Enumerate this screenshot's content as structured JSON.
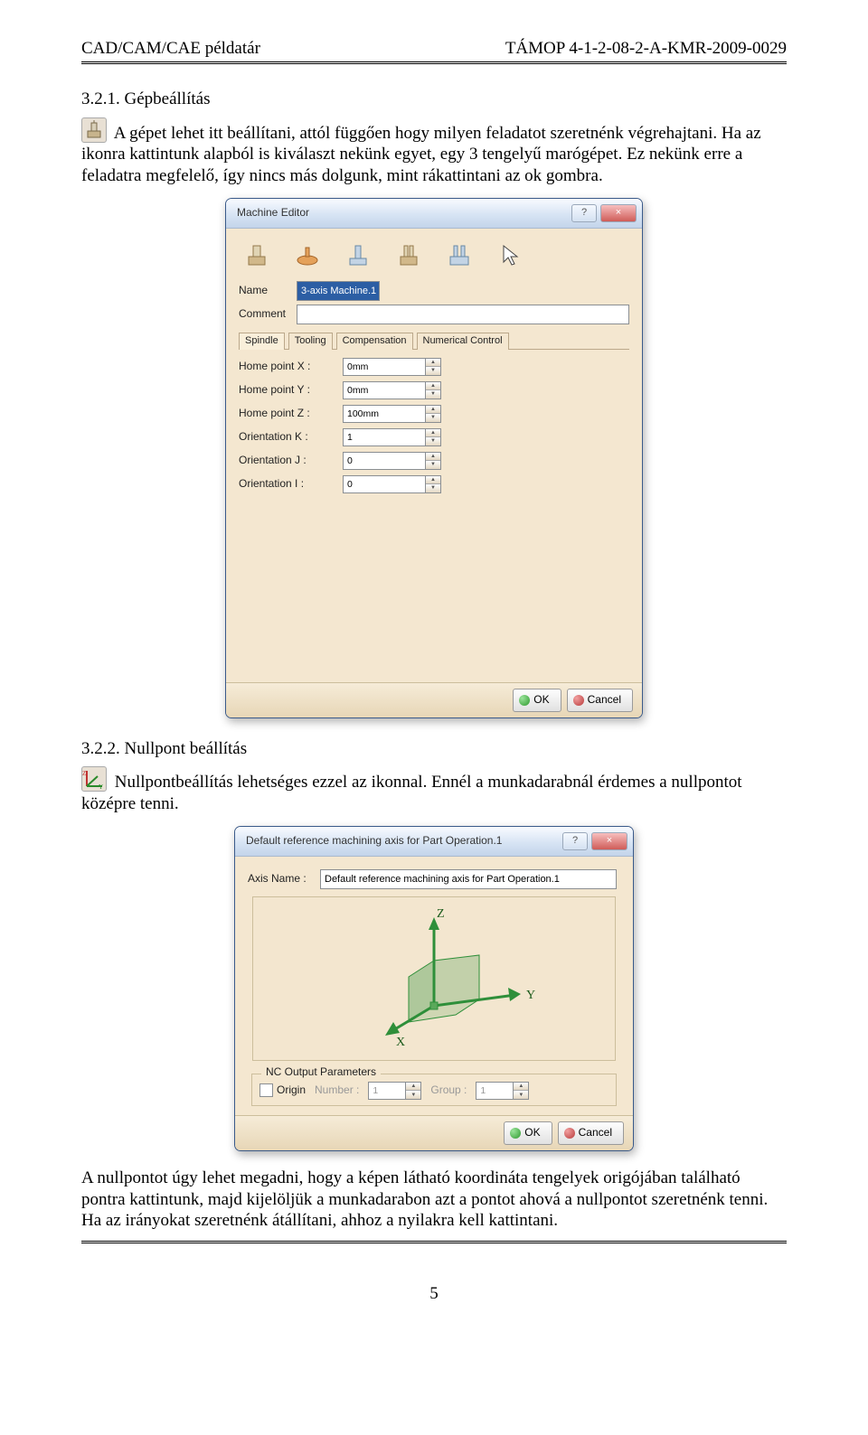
{
  "header": {
    "left": "CAD/CAM/CAE példatár",
    "right": "TÁMOP 4-1-2-08-2-A-KMR-2009-0029"
  },
  "section1": {
    "number": "3.2.1.",
    "title": "Gépbeállítás",
    "para": "A gépet lehet itt beállítani, attól függően hogy milyen feladatot szeretnénk végrehajtani. Ha az ikonra kattintunk alapból is kiválaszt nekünk egyet, egy 3 tengelyű marógépet. Ez nekünk erre a feladatra megfelelő, így nincs más dolgunk, mint rákattintani az ok gombra."
  },
  "dlg1": {
    "title": "Machine Editor",
    "help": "?",
    "close": "×",
    "name_label": "Name",
    "name_value": "3-axis Machine.1",
    "comment_label": "Comment",
    "comment_value": "",
    "tabs": {
      "spindle": "Spindle",
      "tooling": "Tooling",
      "comp": "Compensation",
      "nc": "Numerical Control"
    },
    "fields": [
      {
        "label": "Home point X :",
        "value": "0mm"
      },
      {
        "label": "Home point Y :",
        "value": "0mm"
      },
      {
        "label": "Home point Z :",
        "value": "100mm"
      },
      {
        "label": "Orientation K :",
        "value": "1"
      },
      {
        "label": "Orientation J :",
        "value": "0"
      },
      {
        "label": "Orientation I :",
        "value": "0"
      }
    ]
  },
  "buttons": {
    "ok": "OK",
    "cancel": "Cancel"
  },
  "section2": {
    "number": "3.2.2.",
    "title": "Nullpont beállítás",
    "para": "Nullpontbeállítás lehetséges ezzel az ikonnal. Ennél a munkadarabnál érdemes a nullpontot középre tenni."
  },
  "dlg2": {
    "title": "Default reference machining axis for Part Operation.1",
    "axis_label": "Axis Name :",
    "axis_value": "Default reference machining axis for Part Operation.1",
    "axes": {
      "x": "X",
      "y": "Y",
      "z": "Z"
    },
    "group_title": "NC Output Parameters",
    "origin_label": "Origin",
    "number_label": "Number :",
    "number_value": "1",
    "group_label": "Group :",
    "group_value": "1"
  },
  "para3": "A nullpontot úgy lehet megadni, hogy a képen látható koordináta tengelyek origójában található pontra kattintunk, majd kijelöljük a munkadarabon azt a pontot ahová a nullpontot szeretnénk tenni. Ha az irányokat szeretnénk átállítani, ahhoz a nyilakra kell kattintani.",
  "page_number": "5"
}
